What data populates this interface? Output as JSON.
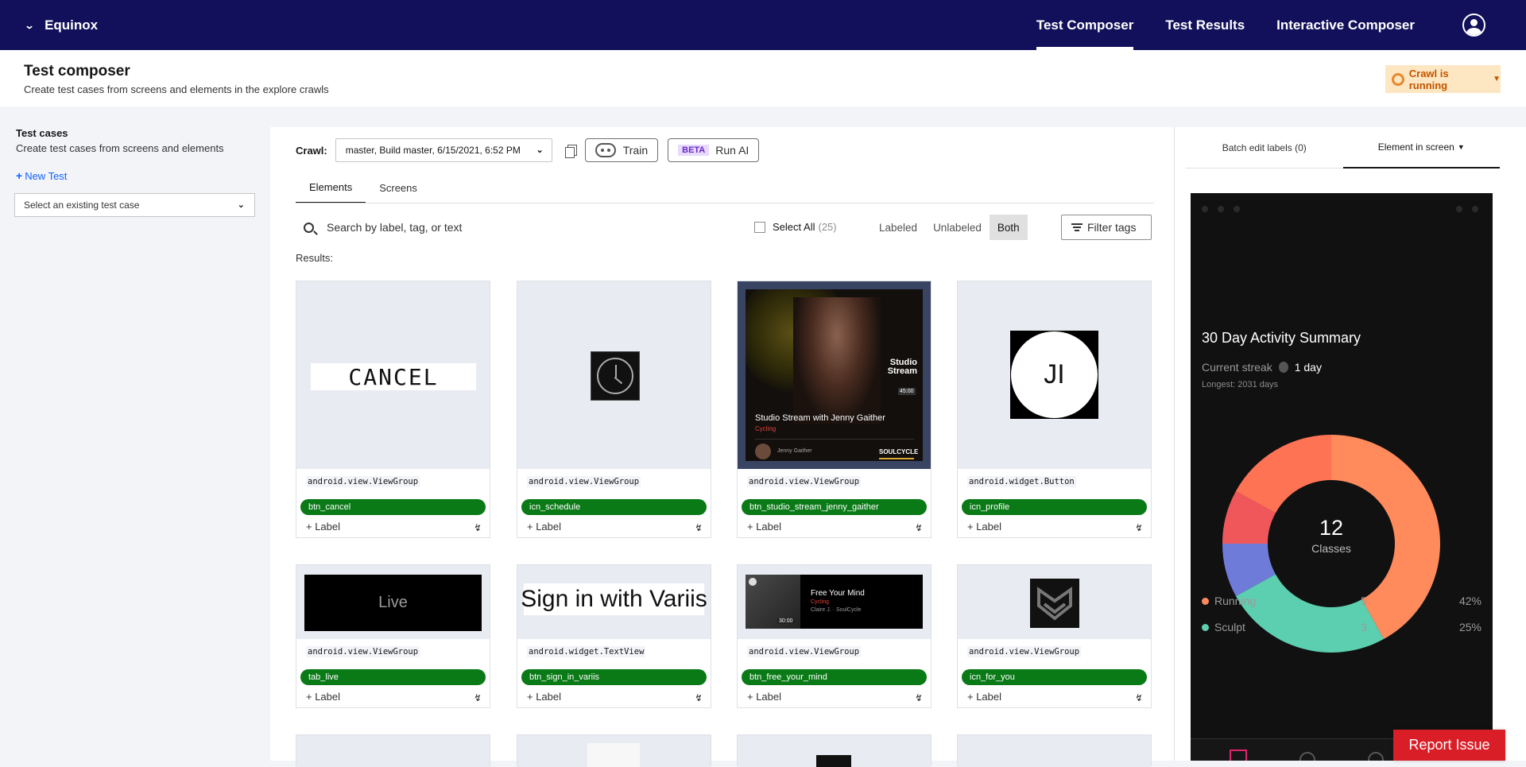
{
  "topbar": {
    "brand": "Equinox",
    "nav": [
      "Test Composer",
      "Test Results",
      "Interactive Composer"
    ],
    "active_nav": "Test Composer"
  },
  "header": {
    "title": "Test composer",
    "subtitle": "Create test cases from screens and elements in the explore crawls",
    "crawl_status": "Crawl is running"
  },
  "left": {
    "title": "Test cases",
    "subtitle": "Create test cases from screens and elements",
    "new_test": "New Test",
    "select_placeholder": "Select an existing test case"
  },
  "toolbar": {
    "crawl_label": "Crawl:",
    "crawl_value": "master, Build master, 6/15/2021, 6:52 PM",
    "train_label": "Train",
    "beta_badge": "BETA",
    "run_ai_label": "Run AI"
  },
  "tabs": [
    "Elements",
    "Screens"
  ],
  "search": {
    "placeholder": "Search by label, tag, or text"
  },
  "select_all": {
    "label": "Select All",
    "count": "(25)"
  },
  "filters": [
    "Labeled",
    "Unlabeled",
    "Both"
  ],
  "active_filter": "Both",
  "filter_tags_label": "Filter tags",
  "results_label": "Results:",
  "label_button": "+ Label",
  "cards": [
    {
      "cls": "android.view.ViewGroup",
      "tag": "btn_cancel",
      "thumb_text": "CANCEL"
    },
    {
      "cls": "android.view.ViewGroup",
      "tag": "icn_schedule"
    },
    {
      "cls": "android.view.ViewGroup",
      "tag": "btn_studio_stream_jenny_gaither",
      "thumb_brand": "Studio Stream",
      "thumb_duration": "45:00",
      "thumb_title": "Studio Stream with Jenny Gaither",
      "thumb_genre": "Cycling",
      "thumb_instructor": "Jenny Gaither",
      "thumb_logo": "SOULCYCLE"
    },
    {
      "cls": "android.widget.Button",
      "tag": "icn_profile",
      "thumb_text": "JI"
    },
    {
      "cls": "android.view.ViewGroup",
      "tag": "tab_live",
      "thumb_text": "Live"
    },
    {
      "cls": "android.widget.TextView",
      "tag": "btn_sign_in_variis",
      "thumb_text": "Sign in with Variis"
    },
    {
      "cls": "android.view.ViewGroup",
      "tag": "btn_free_your_mind",
      "thumb_title": "Free Your Mind",
      "thumb_genre": "Cycling",
      "thumb_instructor": "Claire J. · SoulCycle",
      "thumb_duration": "30:00"
    },
    {
      "cls": "android.view.ViewGroup",
      "tag": "icn_for_you"
    }
  ],
  "right_tabs": [
    "Batch edit labels (0)",
    "Element in screen"
  ],
  "active_right_tab": "Element in screen",
  "phone": {
    "title": "30 Day Activity Summary",
    "streak_label": "Current streak",
    "streak_value": "1 day",
    "longest": "Longest: 2031 days",
    "donut_center_value": "12",
    "donut_center_label": "Classes",
    "legend": [
      {
        "name": "Running",
        "count": "5",
        "pct": "42%",
        "color": "#ff8a5c"
      },
      {
        "name": "Sculpt",
        "count": "3",
        "pct": "25%",
        "color": "#5ccfb0"
      }
    ],
    "donut_segments": [
      {
        "value": 42,
        "color": "#ff8a5c"
      },
      {
        "value": 25,
        "color": "#5ccfb0"
      },
      {
        "value": 8,
        "color": "#6f7bd9"
      },
      {
        "value": 8,
        "color": "#f0575a"
      },
      {
        "value": 17,
        "color": "#ff7355"
      }
    ]
  },
  "report_issue": "Report Issue"
}
